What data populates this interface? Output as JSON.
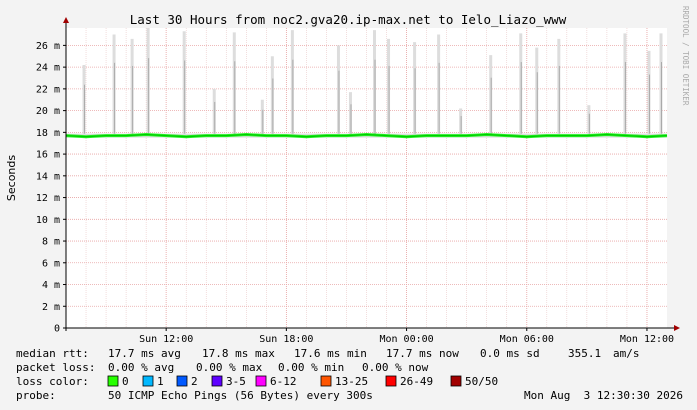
{
  "chart_data": {
    "type": "line",
    "title": "Last 30 Hours from noc2.gva20.ip-max.net to Ielo_Liazo_www",
    "ylabel": "Seconds",
    "watermark": "RRDTOOL / TOBI OETIKER",
    "y_ticks": [
      {
        "value": 0,
        "label": "0"
      },
      {
        "value": 2,
        "label": "2 m"
      },
      {
        "value": 4,
        "label": "4 m"
      },
      {
        "value": 6,
        "label": "6 m"
      },
      {
        "value": 8,
        "label": "8 m"
      },
      {
        "value": 10,
        "label": "10 m"
      },
      {
        "value": 12,
        "label": "12 m"
      },
      {
        "value": 14,
        "label": "14 m"
      },
      {
        "value": 16,
        "label": "16 m"
      },
      {
        "value": 18,
        "label": "18 m"
      },
      {
        "value": 20,
        "label": "20 m"
      },
      {
        "value": 22,
        "label": "22 m"
      },
      {
        "value": 24,
        "label": "24 m"
      },
      {
        "value": 26,
        "label": "26 m"
      }
    ],
    "ylim": [
      0,
      27.6
    ],
    "xlim_hours": [
      0,
      30
    ],
    "x_ticks": [
      {
        "hour": 5,
        "label": "Sun 12:00"
      },
      {
        "hour": 11,
        "label": "Sun 18:00"
      },
      {
        "hour": 17,
        "label": "Mon 00:00"
      },
      {
        "hour": 23,
        "label": "Mon 06:00"
      },
      {
        "hour": 29,
        "label": "Mon 12:00"
      }
    ],
    "median_rtt_ms": 17.7,
    "median_series": {
      "name": "median rtt",
      "x_hours": [
        0,
        1,
        2,
        3,
        4,
        5,
        6,
        7,
        8,
        9,
        10,
        11,
        12,
        13,
        14,
        15,
        16,
        17,
        18,
        19,
        20,
        21,
        22,
        23,
        24,
        25,
        26,
        27,
        28,
        29,
        30
      ],
      "values_ms": [
        17.7,
        17.6,
        17.7,
        17.7,
        17.8,
        17.7,
        17.6,
        17.7,
        17.7,
        17.8,
        17.7,
        17.7,
        17.6,
        17.7,
        17.7,
        17.8,
        17.7,
        17.6,
        17.7,
        17.7,
        17.7,
        17.8,
        17.7,
        17.6,
        17.7,
        17.7,
        17.7,
        17.8,
        17.7,
        17.6,
        17.7
      ]
    },
    "spikes": [
      {
        "hour": 0.9,
        "max_ms": 24.2
      },
      {
        "hour": 2.4,
        "max_ms": 27.0
      },
      {
        "hour": 3.3,
        "max_ms": 26.6
      },
      {
        "hour": 4.1,
        "max_ms": 27.6
      },
      {
        "hour": 5.9,
        "max_ms": 27.3
      },
      {
        "hour": 7.4,
        "max_ms": 22.0
      },
      {
        "hour": 8.4,
        "max_ms": 27.2
      },
      {
        "hour": 9.8,
        "max_ms": 21.0
      },
      {
        "hour": 10.3,
        "max_ms": 25.0
      },
      {
        "hour": 11.3,
        "max_ms": 27.4
      },
      {
        "hour": 13.6,
        "max_ms": 26.0
      },
      {
        "hour": 14.2,
        "max_ms": 21.7
      },
      {
        "hour": 15.4,
        "max_ms": 27.4
      },
      {
        "hour": 16.1,
        "max_ms": 26.6
      },
      {
        "hour": 17.4,
        "max_ms": 26.3
      },
      {
        "hour": 18.6,
        "max_ms": 27.0
      },
      {
        "hour": 19.7,
        "max_ms": 20.2
      },
      {
        "hour": 21.2,
        "max_ms": 25.1
      },
      {
        "hour": 22.7,
        "max_ms": 27.1
      },
      {
        "hour": 23.5,
        "max_ms": 25.8
      },
      {
        "hour": 24.6,
        "max_ms": 26.6
      },
      {
        "hour": 26.1,
        "max_ms": 20.5
      },
      {
        "hour": 27.9,
        "max_ms": 27.1
      },
      {
        "hour": 29.1,
        "max_ms": 25.5
      },
      {
        "hour": 29.7,
        "max_ms": 27.1
      }
    ],
    "colors": {
      "background": "#f3f3f3",
      "plot_background": "#ffffff",
      "grid_minor": "#e9c7c7",
      "grid_major": "#e8a4a4",
      "axis": "#000000",
      "arrow": "#a00000",
      "median": "#00cc00",
      "median_shadow": "#27f527",
      "smoke_light": "#dddddd",
      "smoke_dark": "#aaaaaa",
      "text": "#000000",
      "watermark": "#aaaaaa"
    },
    "grid": true
  },
  "stats": {
    "median_rtt": {
      "label": "median rtt:",
      "avg": "17.7 ms avg",
      "max": "17.8 ms max",
      "min": "17.6 ms min",
      "now": "17.7 ms now",
      "sd": "0.0 ms sd",
      "am": "355.1",
      "am_unit": "am/s"
    },
    "packet_loss": {
      "label": "packet loss:",
      "avg": "0.00 % avg",
      "max": "0.00 % max",
      "min": "0.00 % min",
      "now": "0.00 % now"
    },
    "loss_color": {
      "label": "loss color:",
      "items": [
        {
          "label": "0",
          "color": "#26ff00"
        },
        {
          "label": "1",
          "color": "#00b8ff"
        },
        {
          "label": "2",
          "color": "#0059ff"
        },
        {
          "label": "3-5",
          "color": "#5e00ff"
        },
        {
          "label": "6-12",
          "color": "#ff00ff"
        },
        {
          "label": "13-25",
          "color": "#ff5500"
        },
        {
          "label": "26-49",
          "color": "#ff0000"
        },
        {
          "label": "50/50",
          "color": "#a10000"
        }
      ]
    },
    "probe": {
      "label": "probe:",
      "text": "50 ICMP Echo Pings (56 Bytes) every 300s",
      "timestamp": "Mon Aug  3 12:30:30 2026"
    }
  }
}
